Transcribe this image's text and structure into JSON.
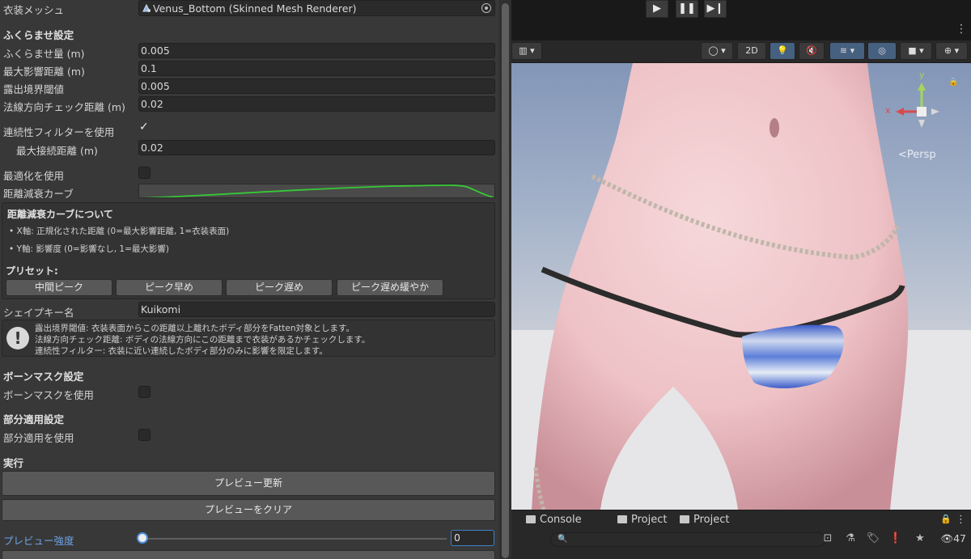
{
  "inspector": {
    "costume_mesh": {
      "label": "衣装メッシュ",
      "value": "Venus_Bottom (Skinned Mesh Renderer)"
    },
    "inflate_section": "ふくらませ設定",
    "inflate_amount": {
      "label": "ふくらませ量 (m)",
      "value": "0.005"
    },
    "max_influence_distance": {
      "label": "最大影響距離 (m)",
      "value": "0.1"
    },
    "exposure_threshold": {
      "label": "露出境界閾値",
      "value": "0.005"
    },
    "normal_check_distance": {
      "label": "法線方向チェック距離 (m)",
      "value": "0.02"
    },
    "use_connectivity_filter": {
      "label": "連続性フィルターを使用",
      "checked": true
    },
    "max_connection_distance": {
      "label": "最大接続距離 (m)",
      "value": "0.02"
    },
    "use_optimization": {
      "label": "最適化を使用",
      "checked": false
    },
    "distance_falloff_curve": {
      "label": "距離減衰カーブ",
      "curve_color": "#36c936"
    },
    "curve_info": {
      "title": "距離減衰カーブについて",
      "bullet_x": "• X軸: 正規化された距離 (0=最大影響距離, 1=衣装表面)",
      "bullet_y": "• Y軸: 影響度 (0=影響なし, 1=最大影響)",
      "presets_label": "プリセット:",
      "presets": [
        "中間ピーク",
        "ピーク早め",
        "ピーク遅め",
        "ピーク遅め緩やか"
      ]
    },
    "shape_key_name": {
      "label": "シェイプキー名",
      "value": "Kuikomi"
    },
    "help": {
      "line1": "露出境界閾値: 衣装表面からこの距離以上離れたボディ部分をFatten対象とします。",
      "line2": "法線方向チェック距離: ボディの法線方向にこの距離まで衣装があるかチェックします。",
      "line3": "連続性フィルター: 衣装に近い連続したボディ部分のみに影響を限定します。"
    },
    "bone_mask_section": "ボーンマスク設定",
    "use_bone_mask": {
      "label": "ボーンマスクを使用",
      "checked": false
    },
    "partial_section": "部分適用設定",
    "use_partial": {
      "label": "部分適用を使用",
      "checked": false
    },
    "execute_section": "実行",
    "preview_update_button": "プレビュー更新",
    "preview_clear_button": "プレビューをクリア",
    "preview_strength": {
      "label": "プレビュー強度",
      "value": "0",
      "fraction": 0
    }
  },
  "scene": {
    "toolbar": {
      "mode_2d": "2D"
    },
    "gizmo": {
      "x_label": "x",
      "y_label": "y",
      "projection": "<Persp"
    },
    "colors": {
      "accent": "#4b8cd8",
      "gizmo_x": "#d84b4b",
      "gizmo_y": "#a3d65a",
      "gizmo_z": "#4b8cd8"
    }
  },
  "bottom": {
    "tabs": [
      "Console",
      "Project",
      "Project"
    ],
    "hidden_count": "47"
  }
}
